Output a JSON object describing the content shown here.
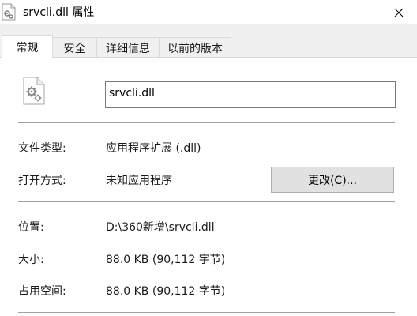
{
  "window": {
    "title": "srvcli.dll 属性"
  },
  "tabs": [
    {
      "label": "常规",
      "active": true
    },
    {
      "label": "安全",
      "active": false
    },
    {
      "label": "详细信息",
      "active": false
    },
    {
      "label": "以前的版本",
      "active": false
    }
  ],
  "general": {
    "file_name": "srvcli.dll",
    "file_type_label": "文件类型:",
    "file_type_value": "应用程序扩展 (.dll)",
    "opens_with_label": "打开方式:",
    "opens_with_value": "未知应用程序",
    "change_button": "更改(C)...",
    "location_label": "位置:",
    "location_value": "D:\\360新增\\srvcli.dll",
    "size_label": "大小:",
    "size_value": "88.0 KB (90,112 字节)",
    "size_on_disk_label": "占用空间:",
    "size_on_disk_value": "88.0 KB (90,112 字节)"
  },
  "icons": {
    "title": "file-gear-icon",
    "file": "dll-file-icon",
    "close": "close-icon"
  }
}
